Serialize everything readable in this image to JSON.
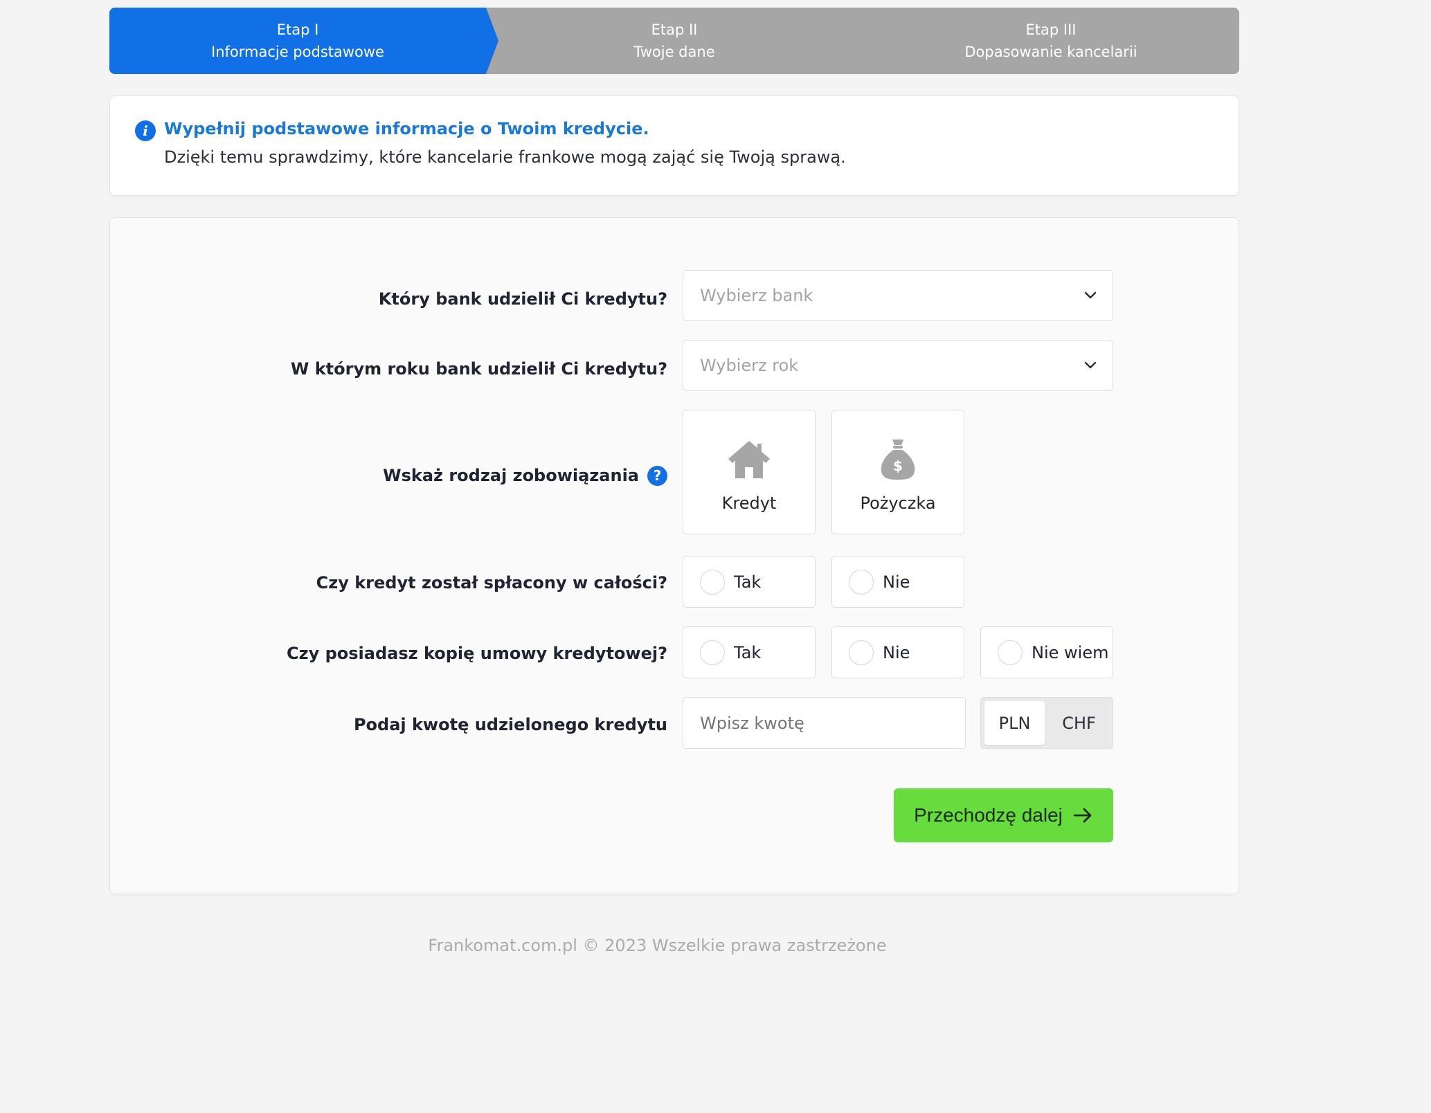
{
  "stepper": {
    "steps": [
      {
        "label": "Etap I",
        "title": "Informacje podstawowe",
        "active": true
      },
      {
        "label": "Etap II",
        "title": "Twoje dane",
        "active": false
      },
      {
        "label": "Etap III",
        "title": "Dopasowanie kancelarii",
        "active": false
      }
    ],
    "active_color": "#1270e7",
    "inactive_color": "#a6a6a6"
  },
  "info": {
    "icon": "info-icon",
    "title": "Wypełnij podstawowe informacje o Twoim kredycie.",
    "subtitle": "Dzięki temu sprawdzimy, które kancelarie frankowe mogą zająć się Twoją sprawą."
  },
  "form": {
    "bank": {
      "label": "Który bank udzielił Ci kredytu?",
      "placeholder": "Wybierz bank"
    },
    "year": {
      "label": "W którym roku bank udzielił Ci kredytu?",
      "placeholder": "Wybierz rok"
    },
    "type": {
      "label": "Wskaż rodzaj zobowiązania",
      "help_glyph": "?",
      "options": [
        {
          "label": "Kredyt",
          "icon": "house-icon"
        },
        {
          "label": "Pożyczka",
          "icon": "money-bag-icon"
        }
      ]
    },
    "repaid": {
      "label": "Czy kredyt został spłacony w całości?",
      "options": [
        "Tak",
        "Nie"
      ]
    },
    "copy": {
      "label": "Czy posiadasz kopię umowy kredytowej?",
      "options": [
        "Tak",
        "Nie",
        "Nie wiem"
      ]
    },
    "amount": {
      "label": "Podaj kwotę udzielonego kredytu",
      "placeholder": "Wpisz kwotę",
      "currencies": [
        "PLN",
        "CHF"
      ],
      "selected_currency": "PLN"
    },
    "next_label": "Przechodzę dalej",
    "next_color": "#66dd3c"
  },
  "footer": {
    "text": "Frankomat.com.pl © 2023 Wszelkie prawa zastrzeżone"
  }
}
